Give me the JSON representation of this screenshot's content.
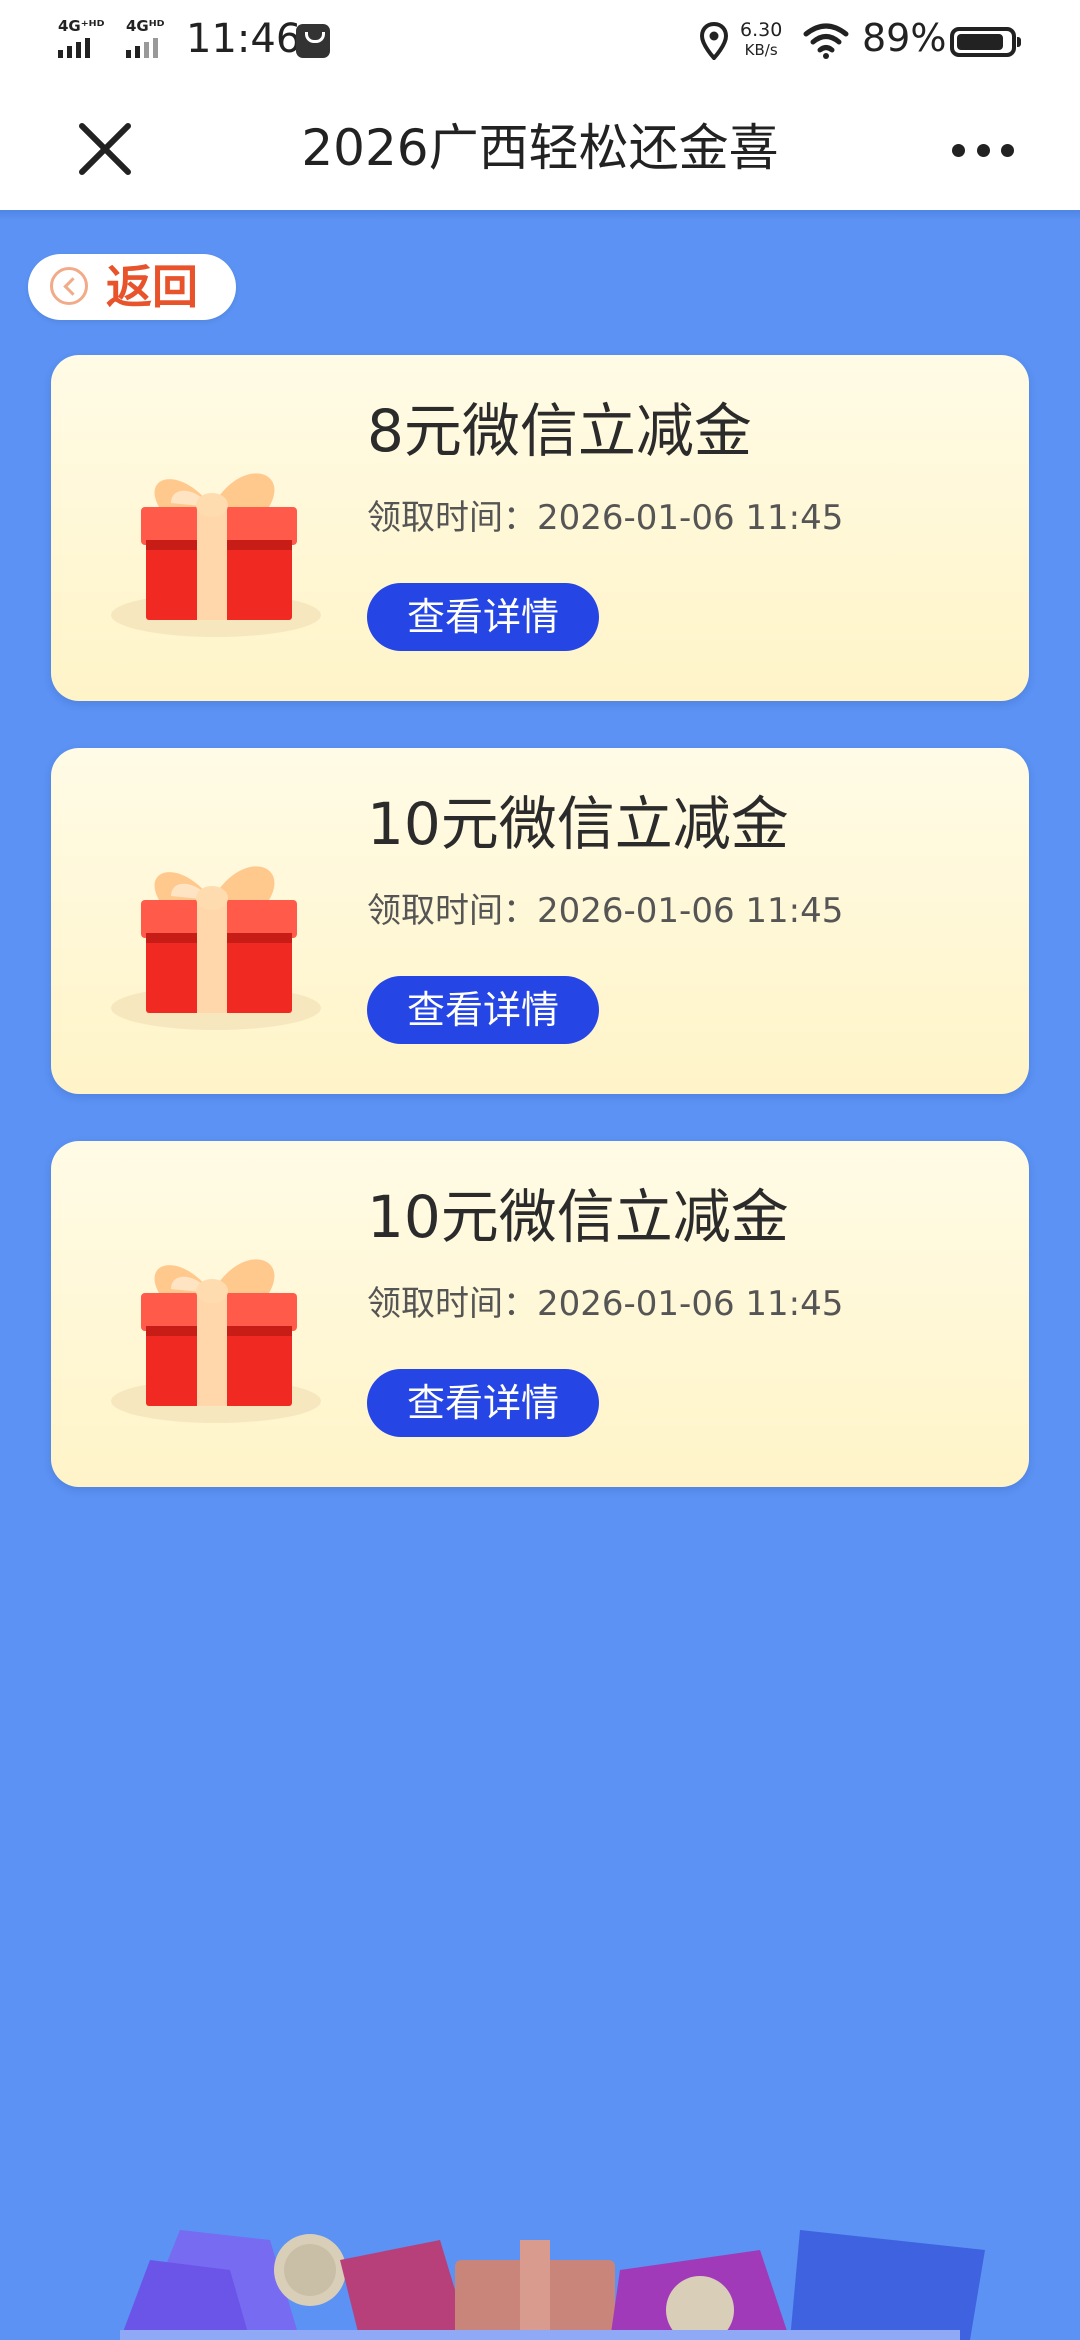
{
  "status_bar": {
    "signal_1_label": "4G⁺ᴴᴰ",
    "signal_2_label": "4Gᴴᴰ",
    "time": "11:46",
    "net_speed_value": "6.30",
    "net_speed_unit": "KB/s",
    "battery_pct": "89%",
    "battery_level": 0.89,
    "icons": [
      "signal-icon",
      "shopping-bag-icon",
      "location-icon",
      "wifi-icon",
      "battery-icon"
    ]
  },
  "nav": {
    "title": "2026广西轻松还金喜",
    "close_icon": "close-icon",
    "more_icon": "more-icon"
  },
  "back_button": {
    "label": "返回",
    "icon": "chevron-left-icon"
  },
  "colors": {
    "background": "#5b92f3",
    "card_background": "#fff6d2",
    "button_blue": "#2545e5",
    "back_text": "#e8532b"
  },
  "rewards": [
    {
      "title": "8元微信立减金",
      "time_label": "领取时间：",
      "time_value": "2026-01-06 11:45",
      "button_label": "查看详情",
      "icon": "gift-box-icon"
    },
    {
      "title": "10元微信立减金",
      "time_label": "领取时间：",
      "time_value": "2026-01-06 11:45",
      "button_label": "查看详情",
      "icon": "gift-box-icon"
    },
    {
      "title": "10元微信立减金",
      "time_label": "领取时间：",
      "time_value": "2026-01-06 11:45",
      "button_label": "查看详情",
      "icon": "gift-box-icon"
    }
  ]
}
